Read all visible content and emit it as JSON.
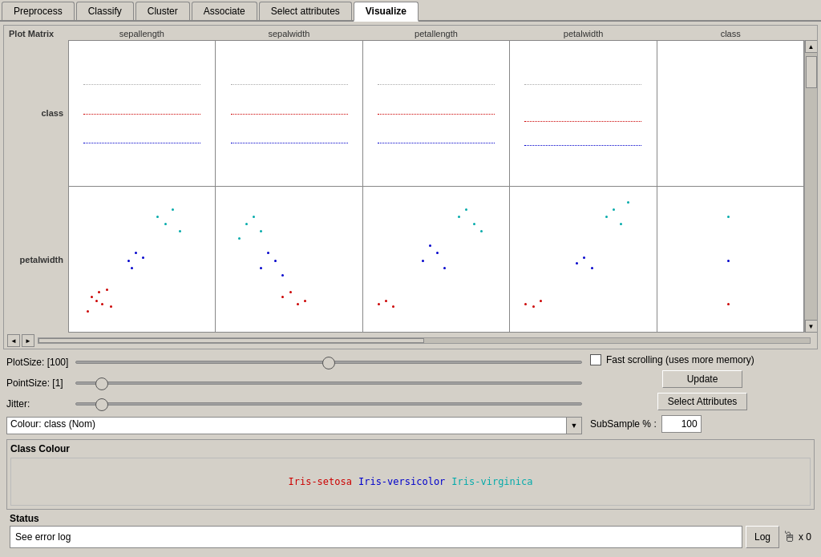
{
  "tabs": [
    {
      "label": "Preprocess",
      "active": false
    },
    {
      "label": "Classify",
      "active": false
    },
    {
      "label": "Cluster",
      "active": false
    },
    {
      "label": "Associate",
      "active": false
    },
    {
      "label": "Select attributes",
      "active": false
    },
    {
      "label": "Visualize",
      "active": true
    }
  ],
  "plotMatrix": {
    "title": "Plot Matrix",
    "columns": [
      "sepallength",
      "sepalwidth",
      "petallength",
      "petalwidth",
      "class"
    ],
    "rows": [
      {
        "label": "class"
      },
      {
        "label": "petalwidth"
      }
    ]
  },
  "controls": {
    "plotSize": {
      "label": "PlotSize: [100]",
      "value": 50
    },
    "pointSize": {
      "label": "PointSize: [1]",
      "value": 5
    },
    "jitter": {
      "label": "Jitter:",
      "value": 5
    },
    "colour": {
      "label": "Colour: class  (Nom)",
      "placeholder": "Colour: class  (Nom)"
    },
    "fastScrolling": {
      "label": "Fast scrolling (uses more memory)",
      "checked": false
    },
    "updateBtn": "Update",
    "selectAttributesBtn": "Select Attributes",
    "subSampleLabel": "SubSample % :",
    "subSampleValue": "100"
  },
  "classColour": {
    "title": "Class Colour",
    "classes": [
      {
        "label": "Iris-setosa",
        "color": "#cc0000"
      },
      {
        "label": "Iris-versicolor",
        "color": "#0000cc"
      },
      {
        "label": "Iris-virginica",
        "color": "#00aaaa"
      }
    ]
  },
  "status": {
    "title": "Status",
    "message": "See error log",
    "logBtn": "Log",
    "timesIcon": "x 0"
  }
}
